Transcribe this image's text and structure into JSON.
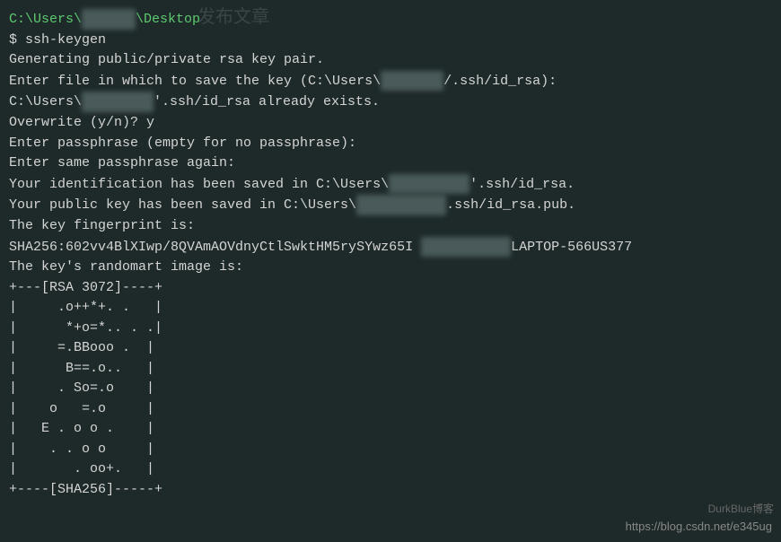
{
  "terminal": {
    "cwd_prefix": "C:\\Users\\",
    "cwd_suffix": "\\Desktop",
    "prompt": "$ ",
    "command": "ssh-keygen",
    "lines": {
      "generating": "Generating public/private rsa key pair.",
      "enter_file_prefix": "Enter file in which to save the key (C:\\Users\\",
      "enter_file_suffix": "/.ssh/id_rsa):",
      "exists_prefix": "C:\\Users\\",
      "exists_suffix": "'.ssh/id_rsa already exists.",
      "overwrite": "Overwrite (y/n)? y",
      "enter_passphrase": "Enter passphrase (empty for no passphrase):",
      "enter_same_passphrase": "Enter same passphrase again:",
      "id_saved_prefix": "Your identification has been saved in C:\\Users\\",
      "id_saved_suffix": "'.ssh/id_rsa.",
      "pub_saved_prefix": "Your public key has been saved in C:\\Users\\",
      "pub_saved_suffix": ".ssh/id_rsa.pub.",
      "fingerprint_label": "The key fingerprint is:",
      "fingerprint_prefix": "SHA256:602vv4BlXIwp/8QVAmAOVdnyCtlSwktHM5rySYwz65I ",
      "fingerprint_suffix": "LAPTOP-566US377",
      "randomart_label": "The key's randomart image is:",
      "art_top": "+---[RSA 3072]----+",
      "art_1": "|     .o++*+. .   |",
      "art_2": "|      *+o=*.. . .|",
      "art_3": "|     =.BBooo .  |",
      "art_4": "|      B==.o..   |",
      "art_5": "|     . So=.o    |",
      "art_6": "|    o   =.o     |",
      "art_7": "|   E . o o .    |",
      "art_8": "|    . . o o     |",
      "art_9": "|       . oo+.   |",
      "art_bottom": "+----[SHA256]-----+"
    }
  },
  "watermark": {
    "url": "https://blog.csdn.net/e345ug",
    "corner": "DurkBlue博客"
  },
  "ghost": {
    "header": "发布文章"
  }
}
